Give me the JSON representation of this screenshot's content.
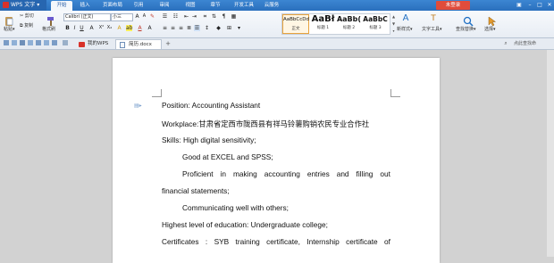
{
  "app": {
    "name": "WPS 文字"
  },
  "menu_tabs": [
    "开始",
    "插入",
    "页面布局",
    "引用",
    "审阅",
    "视图",
    "章节",
    "开发工具",
    "云服务"
  ],
  "login_label": "未登录",
  "ribbon": {
    "paste": "粘贴",
    "cut": "剪切",
    "copy": "复制",
    "format_painter": "格式刷",
    "font_name": "Calibri (正文)",
    "font_size": "小三",
    "styles": [
      {
        "sample": "AaBbCcDd",
        "label": "正文"
      },
      {
        "sample": "AaBł",
        "label": "标题 1"
      },
      {
        "sample": "AaBb(",
        "label": "标题 2"
      },
      {
        "sample": "AaBbC",
        "label": "标题 3"
      }
    ],
    "new_style": "新样式",
    "text_tools": "文字工具",
    "find_replace": "查找替换",
    "select": "选择"
  },
  "doc_tabs": [
    "我的WPS",
    "简历.docx"
  ],
  "help_search": "点此查找命",
  "document": {
    "line1": "Position: Accounting Assistant",
    "line2": "Workplace:甘肃省定西市陇西县有祥马铃薯购销农民专业合作社",
    "line3": "Skills: High digital sensitivity;",
    "line4": "Good at EXCEL and SPSS;",
    "line5_words": [
      "Proficient",
      "in",
      "making",
      "accounting",
      "entries",
      "and",
      "filling",
      "out"
    ],
    "line6": "financial statements;",
    "line7": "Communicating well with others;",
    "line8": "Highest level of education: Undergraduate college;",
    "line9_words": [
      "Certificates",
      ":",
      "SYB",
      "training",
      "certificate,",
      "Internship",
      "certificate",
      "of"
    ]
  }
}
